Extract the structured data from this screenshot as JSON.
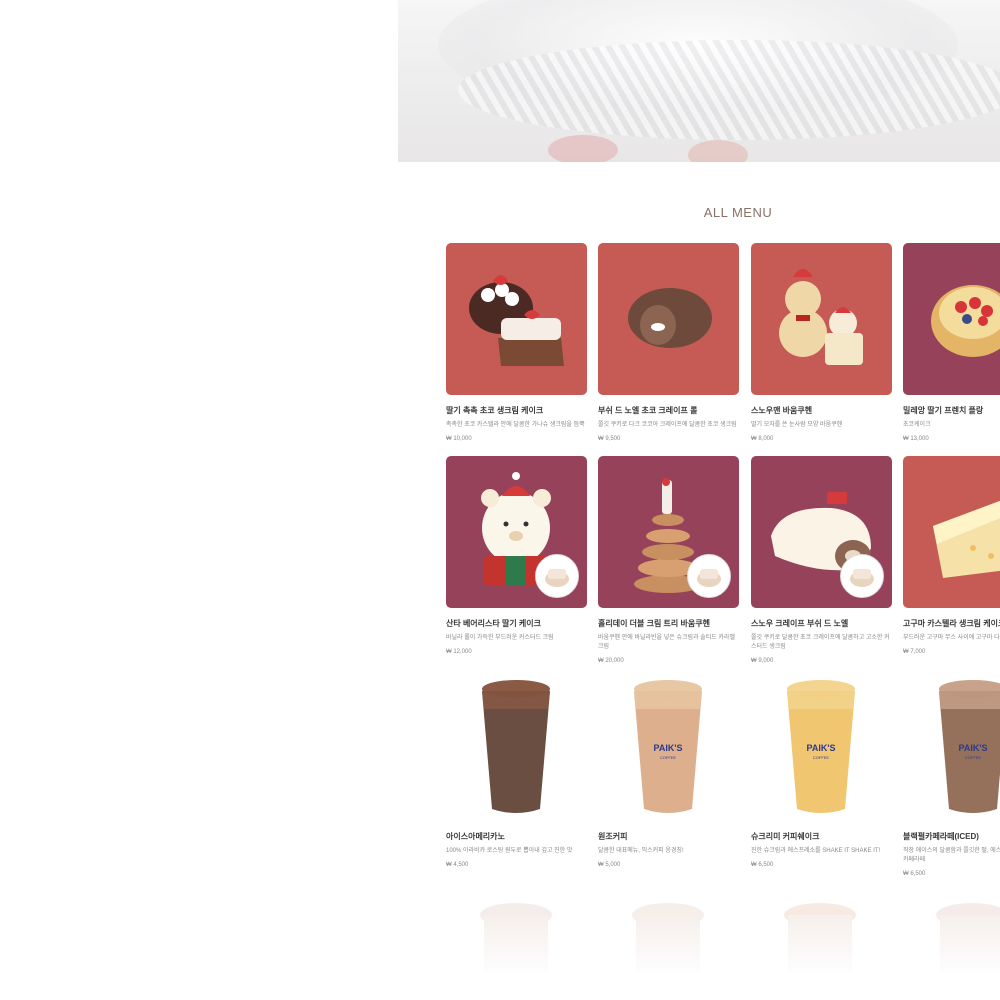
{
  "section_title": "ALL MENU",
  "colors": {
    "red": "#c65a55",
    "maroon": "#96425a",
    "title": "#8a7068"
  },
  "rows": [
    {
      "items": [
        {
          "name": "딸기 촉촉 초코 생크림 케이크",
          "desc": "촉촉한 초코 카스텔라 안에 달콤한 가나슈 생크림을 듬뿍",
          "price": "₩ 10,000",
          "bg": "red",
          "icon": "strawberry-choco-cake-icon"
        },
        {
          "name": "부쉬 드 노엘 초코 크레이프 롤",
          "desc": "쫄깃 쿠키로 다크 코코아 크레이프에 달콤한 초코 생크림",
          "price": "₩ 9,500",
          "bg": "red",
          "icon": "crepe-roll-icon"
        },
        {
          "name": "스노우맨 바움쿠헨",
          "desc": "딸기 모자를 쓴 눈사람 모양 바움쿠헨",
          "price": "₩ 8,000",
          "bg": "red",
          "icon": "snowman-baumkuchen-icon"
        },
        {
          "name": "밀레앙 딸기 프렌치 플랑",
          "desc": "초코케이크",
          "price": "₩ 13,000",
          "bg": "maroon",
          "icon": "strawberry-flan-icon"
        }
      ]
    },
    {
      "items": [
        {
          "name": "산타 베어리스타 딸기 케이크",
          "desc": "바닐라 롤이 가득한 부드러운 커스터드 크림",
          "price": "₩ 12,000",
          "bg": "maroon",
          "icon": "santa-bear-cake-icon"
        },
        {
          "name": "홀리데이 더블 크림 트리 바움쿠헨",
          "desc": "바움쿠헨 안에 바닐라빈을 넣은 슈크림과 솔티드 카라멜 크림",
          "price": "₩ 20,000",
          "bg": "maroon",
          "icon": "tree-baumkuchen-icon"
        },
        {
          "name": "스노우 크레이프 부쉬 드 노엘",
          "desc": "쫄깃 쿠키로 달콤한 초코 크레이프에 달콤하고 고소한 커스터드 생크림",
          "price": "₩ 9,000",
          "bg": "maroon",
          "icon": "snow-crepe-roll-icon"
        },
        {
          "name": "고구마 카스텔라 생크림 케이크",
          "desc": "부드러운 고구마 무스 사이에 고구마 다이스",
          "price": "₩ 7,000",
          "bg": "red",
          "icon": "sweet-potato-cake-icon"
        }
      ]
    },
    {
      "items": [
        {
          "name": "아이스아메리카노",
          "desc": "100% 아라비카 로스팅 원두로 뽑아내 깊고 진한 맛",
          "price": "₩ 4,500",
          "bg": "white",
          "icon": "iced-americano-icon"
        },
        {
          "name": "원조커피",
          "desc": "달콤한 대표메뉴, 믹스커피 응경칭!",
          "price": "₩ 5,000",
          "bg": "white",
          "icon": "original-coffee-icon"
        },
        {
          "name": "슈크리미 커피쉐이크",
          "desc": "진한 슈크림과 에스프레소를 SHAKE IT SHAKE IT!",
          "price": "₩ 6,500",
          "bg": "white",
          "icon": "cream-coffee-shake-icon"
        },
        {
          "name": "블랙펄카페라떼(ICED)",
          "desc": "직장 에이스의 달콤함과 쫄깃한 펄, 에스프레소의 블랙펄카페라떼",
          "price": "₩ 6,500",
          "bg": "white",
          "icon": "black-pearl-latte-icon"
        }
      ]
    }
  ],
  "cup_label": "PAIK'S",
  "cup_sub": "COFFEE"
}
